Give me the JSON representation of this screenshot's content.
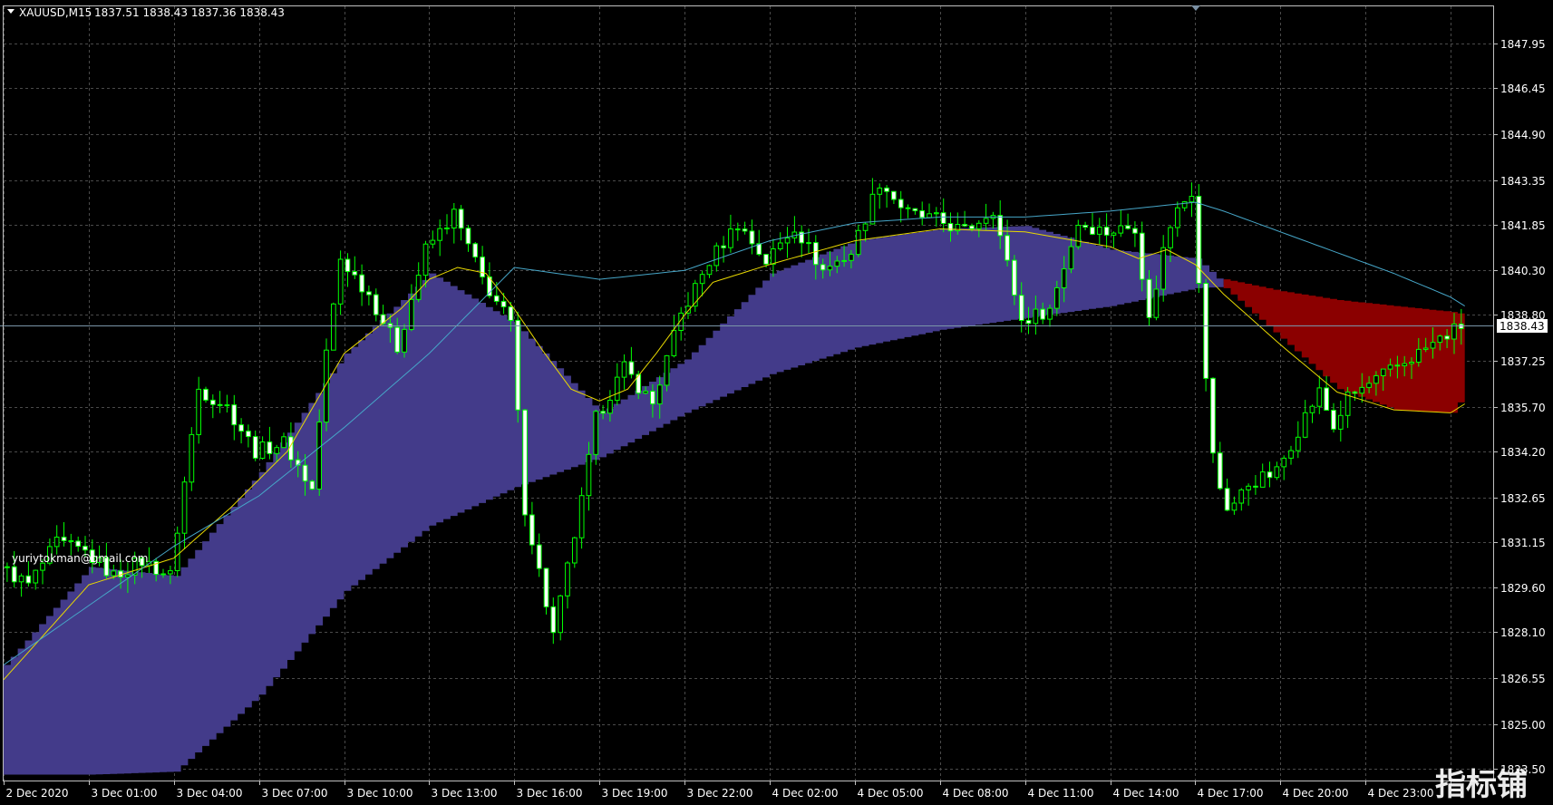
{
  "window": {
    "symbol_label": "XAUUSD,M15",
    "ohlc_label": "1837.51 1838.43 1837.36 1838.43",
    "annotation": "yuriytokman@gmail.com",
    "watermark": "指标铺"
  },
  "colors": {
    "background": "#000000",
    "grid": "#4a4a4a",
    "bull_candle": "#00ff00",
    "bear_body": "#ffffff",
    "wick": "#00ff00",
    "upper_band": "#433b8a",
    "lower_band": "#8b0000",
    "ma_fast": "#e8d800",
    "ma_slow": "#46a6c8",
    "price_line": "#7a95a8",
    "price_label_bg": "#ffffff",
    "price_label_fg": "#000000"
  },
  "chart_data": {
    "type": "candlestick",
    "symbol": "XAUUSD",
    "timeframe": "M15",
    "current_price": 1838.43,
    "current_price_label": "1838.43",
    "ylim": [
      1823.5,
      1849.0
    ],
    "y_ticks": [
      1847.95,
      1846.45,
      1844.9,
      1843.35,
      1841.85,
      1840.3,
      1838.8,
      1837.25,
      1835.7,
      1834.2,
      1832.65,
      1831.15,
      1829.6,
      1828.1,
      1826.55,
      1825.0,
      1823.5
    ],
    "y_tick_labels": [
      "1847.95",
      "1846.45",
      "1844.90",
      "1843.35",
      "1841.85",
      "1840.30",
      "1838.80",
      "1837.25",
      "1835.70",
      "1834.20",
      "1832.65",
      "1831.15",
      "1829.60",
      "1828.10",
      "1826.55",
      "1825.00",
      "1823.50"
    ],
    "x_range_hours": [
      0,
      52.5
    ],
    "x_ticks_hours": [
      0,
      3,
      6,
      9,
      12,
      15,
      18,
      21,
      24,
      27,
      30,
      33,
      36,
      39,
      42,
      45,
      48,
      51
    ],
    "x_tick_labels": [
      "2 Dec 2020",
      "3 Dec 01:00",
      "3 Dec 04:00",
      "3 Dec 07:00",
      "3 Dec 10:00",
      "3 Dec 13:00",
      "3 Dec 16:00",
      "3 Dec 19:00",
      "3 Dec 22:00",
      "4 Dec 02:00",
      "4 Dec 05:00",
      "4 Dec 08:00",
      "4 Dec 11:00",
      "4 Dec 14:00",
      "4 Dec 17:00",
      "4 Dec 20:00",
      "4 Dec 23:00"
    ],
    "price_path": [
      [
        0,
        1830.3
      ],
      [
        1,
        1829.7
      ],
      [
        2,
        1831.1
      ],
      [
        3,
        1830.8
      ],
      [
        4,
        1830.0
      ],
      [
        5,
        1830.5
      ],
      [
        6,
        1830.0
      ],
      [
        7,
        1836.3
      ],
      [
        8,
        1835.7
      ],
      [
        9,
        1834.2
      ],
      [
        10,
        1834.5
      ],
      [
        11,
        1832.9
      ],
      [
        11.5,
        1837.5
      ],
      [
        12,
        1840.7
      ],
      [
        13,
        1839.5
      ],
      [
        14,
        1837.7
      ],
      [
        15,
        1841.0
      ],
      [
        16,
        1842.2
      ],
      [
        17,
        1840.0
      ],
      [
        18,
        1838.5
      ],
      [
        18.5,
        1832.3
      ],
      [
        19.5,
        1828.0
      ],
      [
        20.5,
        1832.5
      ],
      [
        21,
        1835.3
      ],
      [
        22,
        1837.0
      ],
      [
        23,
        1835.8
      ],
      [
        24,
        1838.8
      ],
      [
        25,
        1840.6
      ],
      [
        26,
        1841.9
      ],
      [
        27,
        1840.6
      ],
      [
        28,
        1841.8
      ],
      [
        29,
        1840.3
      ],
      [
        30,
        1840.9
      ],
      [
        31,
        1843.3
      ],
      [
        32,
        1842.2
      ],
      [
        33,
        1842.0
      ],
      [
        34,
        1841.6
      ],
      [
        35,
        1842.4
      ],
      [
        36,
        1838.6
      ],
      [
        37,
        1839.0
      ],
      [
        38,
        1841.9
      ],
      [
        39,
        1841.6
      ],
      [
        40,
        1841.8
      ],
      [
        40.5,
        1838.6
      ],
      [
        41,
        1841.0
      ],
      [
        41.5,
        1842.6
      ],
      [
        42,
        1843.0
      ],
      [
        42.4,
        1837.8
      ],
      [
        42.8,
        1833.5
      ],
      [
        43.3,
        1832.2
      ],
      [
        44,
        1833.1
      ],
      [
        45,
        1833.5
      ],
      [
        46,
        1835.4
      ],
      [
        46.5,
        1836.2
      ],
      [
        47,
        1835.0
      ],
      [
        47.5,
        1836.0
      ],
      [
        51.5,
        1838.43
      ]
    ],
    "series": [
      {
        "name": "",
        "kind": "band",
        "color": "#433b8a",
        "x": [
          0,
          3,
          6,
          9,
          12,
          15,
          18,
          21,
          24,
          27,
          30,
          33,
          36,
          39,
          42,
          44
        ],
        "upper": [
          1827.0,
          1830.3,
          1830.0,
          1833.5,
          1837.5,
          1840.2,
          1838.5,
          1835.5,
          1837.3,
          1840.2,
          1841.3,
          1841.7,
          1841.8,
          1841.0,
          1840.7,
          1838.9
        ],
        "lower": [
          1823.3,
          1823.3,
          1823.4,
          1826.0,
          1829.5,
          1831.7,
          1833.0,
          1834.0,
          1835.5,
          1836.8,
          1837.7,
          1838.3,
          1838.7,
          1839.1,
          1839.7,
          1839.8
        ]
      },
      {
        "name": "",
        "kind": "band",
        "color": "#8b0000",
        "x": [
          43,
          45,
          47,
          49,
          51,
          51.5
        ],
        "upper": [
          1840.0,
          1839.6,
          1839.3,
          1839.1,
          1838.9,
          1838.8
        ],
        "lower": [
          1839.7,
          1838.0,
          1836.3,
          1835.6,
          1835.5,
          1836.2
        ]
      },
      {
        "name": "",
        "kind": "line",
        "color": "#e8d800",
        "x": [
          0,
          3,
          6,
          8,
          10,
          12,
          14,
          15,
          16,
          17,
          18,
          19,
          20,
          21,
          22,
          23,
          24,
          25,
          27,
          30,
          33,
          36,
          39,
          40,
          41,
          42,
          43,
          45,
          47,
          49,
          51,
          51.5
        ],
        "y": [
          1826.5,
          1829.7,
          1830.6,
          1832.3,
          1834.2,
          1837.5,
          1839.0,
          1840.0,
          1840.4,
          1840.2,
          1839.0,
          1837.6,
          1836.3,
          1835.9,
          1836.3,
          1837.5,
          1838.8,
          1839.9,
          1840.5,
          1841.3,
          1841.7,
          1841.6,
          1841.1,
          1840.7,
          1841.0,
          1840.5,
          1839.5,
          1837.8,
          1836.2,
          1835.6,
          1835.5,
          1835.8
        ]
      },
      {
        "name": "",
        "kind": "line",
        "color": "#46a6c8",
        "x": [
          0,
          3,
          6,
          9,
          12,
          15,
          18,
          21,
          24,
          27,
          30,
          33,
          36,
          39,
          42,
          43,
          45,
          47,
          49,
          51,
          51.5
        ],
        "y": [
          1827.0,
          1829.0,
          1831.0,
          1832.7,
          1835.0,
          1837.5,
          1840.4,
          1840.0,
          1840.3,
          1841.3,
          1841.9,
          1842.1,
          1842.1,
          1842.3,
          1842.6,
          1842.3,
          1841.6,
          1840.9,
          1840.2,
          1839.4,
          1839.1
        ]
      }
    ],
    "grid": true,
    "legend": "none"
  }
}
